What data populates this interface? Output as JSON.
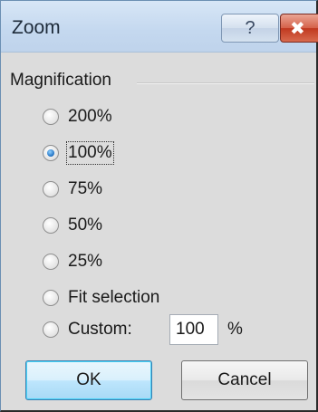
{
  "window": {
    "title": "Zoom",
    "help_glyph": "?",
    "close_glyph": "✖"
  },
  "magnification": {
    "group_label": "Magnification",
    "options": [
      {
        "label": "200%",
        "selected": false
      },
      {
        "label": "100%",
        "selected": true
      },
      {
        "label": "75%",
        "selected": false
      },
      {
        "label": "50%",
        "selected": false
      },
      {
        "label": "25%",
        "selected": false
      },
      {
        "label": "Fit selection",
        "selected": false
      },
      {
        "label": "Custom:",
        "selected": false
      }
    ],
    "custom_value": "100",
    "custom_unit": "%"
  },
  "buttons": {
    "ok_label": "OK",
    "cancel_label": "Cancel"
  },
  "colors": {
    "titlebar": "#c4d8ef",
    "close_button": "#c0381f",
    "ok_border": "#3c7fb1",
    "radio_selected": "#1e6fc0"
  }
}
